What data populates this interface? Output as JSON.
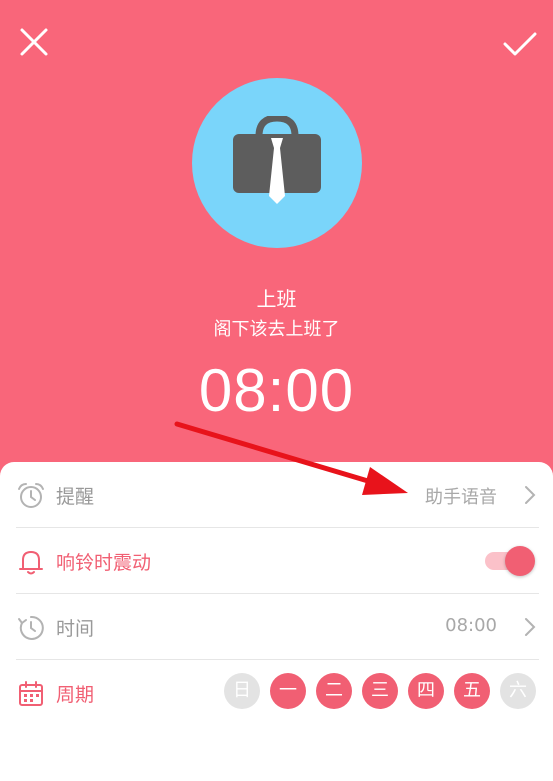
{
  "header": {
    "title": "上班",
    "subtitle": "阁下该去上班了",
    "time": "08:00"
  },
  "icons": {
    "close": "close-icon",
    "confirm": "check-icon",
    "category": "briefcase-tie-icon"
  },
  "settings": {
    "reminder": {
      "label": "提醒",
      "value": "助手语音",
      "icon": "alarm-clock-icon"
    },
    "vibrate": {
      "label": "响铃时震动",
      "on": true,
      "icon": "bell-icon"
    },
    "time": {
      "label": "时间",
      "value": "08:00",
      "icon": "clock-arrow-icon"
    },
    "repeat": {
      "label": "周期",
      "icon": "calendar-icon",
      "days": [
        {
          "label": "日",
          "selected": false
        },
        {
          "label": "一",
          "selected": true
        },
        {
          "label": "二",
          "selected": true
        },
        {
          "label": "三",
          "selected": true
        },
        {
          "label": "四",
          "selected": true
        },
        {
          "label": "五",
          "selected": true
        },
        {
          "label": "六",
          "selected": false
        }
      ]
    }
  },
  "colors": {
    "header_bg": "#f9667a",
    "accent": "#f15f73",
    "icon_circle": "#7ad5fa",
    "day_off": "#e3e3e3",
    "annotation_arrow": "#e8131b"
  }
}
